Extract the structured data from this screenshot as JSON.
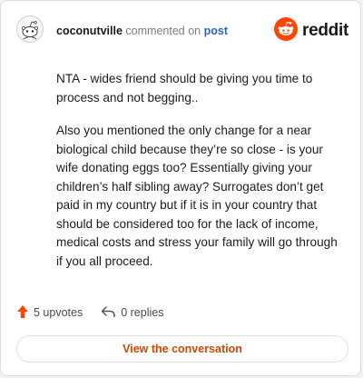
{
  "comment": {
    "username": "coconutville",
    "verb": "commented on",
    "target": "post",
    "paragraphs": [
      "NTA - wides friend should be giving you time to process and not begging..",
      "Also you mentioned the only change for a near biological child because they’re so close - is your wife donating eggs too? Essentially giving your children’s half sibling away? Surrogates don’t get paid in my country but if it is in your country that should be considered too for the lack of income, medical costs and stress your family will go through if you all proceed."
    ]
  },
  "brand": {
    "name": "reddit",
    "color": "#ff4500"
  },
  "footer": {
    "upvotes": "5 upvotes",
    "replies": "0 replies"
  },
  "actions": {
    "view_conversation": "View the conversation"
  },
  "colors": {
    "accent": "#d14400",
    "link": "#2a64c8",
    "upvote": "#ff4500"
  },
  "icons": [
    "snoo-avatar-icon",
    "reddit-logo-icon",
    "upvote-arrow-icon",
    "reply-arrow-icon"
  ]
}
